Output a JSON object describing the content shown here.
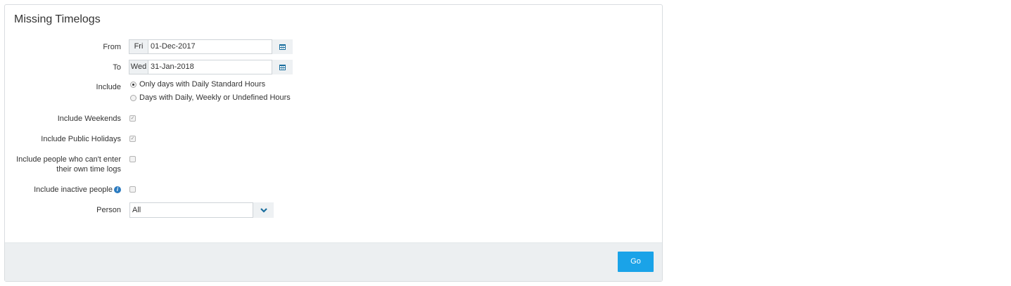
{
  "title": "Missing Timelogs",
  "from": {
    "label": "From",
    "day": "Fri",
    "date": "01-Dec-2017"
  },
  "to": {
    "label": "To",
    "day": "Wed",
    "date": "31-Jan-2018"
  },
  "include": {
    "label": "Include",
    "options": [
      {
        "label": "Only days with Daily Standard Hours",
        "selected": true
      },
      {
        "label": "Days with Daily, Weekly or Undefined Hours",
        "selected": false
      }
    ]
  },
  "include_weekends": {
    "label": "Include Weekends",
    "checked": true
  },
  "include_public_holidays": {
    "label": "Include Public Holidays",
    "checked": true
  },
  "include_no_entry": {
    "label_line1": "Include people who can't enter",
    "label_line2": "their own time logs",
    "checked": false
  },
  "include_inactive": {
    "label": "Include inactive people",
    "checked": false
  },
  "person": {
    "label": "Person",
    "value": "All"
  },
  "go_label": "Go",
  "colors": {
    "accent": "#1aa3e8",
    "icon": "#1a6e9e",
    "footer": "#eceff1"
  }
}
